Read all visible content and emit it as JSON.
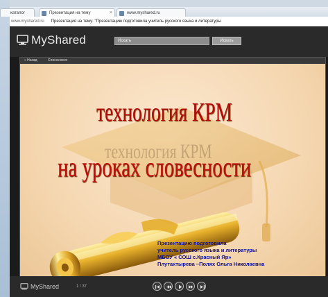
{
  "browser": {
    "tabs": [
      {
        "label": "каталог"
      },
      {
        "label": "Презентация на тему"
      },
      {
        "label": "www.myshared.ru"
      }
    ],
    "address": {
      "url": "www.myshared.ru",
      "page_title": "Презентация на тему: \"Презентацию подготовила учитель русского языка и литературы"
    }
  },
  "header": {
    "logo_text": "MyShared",
    "search_placeholder": "Искать",
    "search_button": "Искать"
  },
  "viewer": {
    "nav_back": "« Назад",
    "nav_all": "Список всех"
  },
  "slide": {
    "title_line1": "технология  КРМ",
    "title_ghost": "технология  КРМ",
    "title_line2": "на уроках словесности",
    "author_lines": [
      "Презентацию подготовила",
      "учитель русского языка и литературы",
      "МБОУ « СОШ с.Красный  Яр»",
      " Плутахтырева –Полях Ольга Николаевна"
    ]
  },
  "footer": {
    "logo_text": "MyShared",
    "page_indicator": "1 / 37"
  },
  "icons": [
    "myshared-logo-icon",
    "first-slide-icon",
    "prev-slide-icon",
    "play-icon",
    "next-slide-icon",
    "last-slide-icon"
  ],
  "colors": {
    "title_red": "#c30d0d",
    "author_blue": "#0d0e96",
    "header_bg": "#2a2a2a"
  }
}
